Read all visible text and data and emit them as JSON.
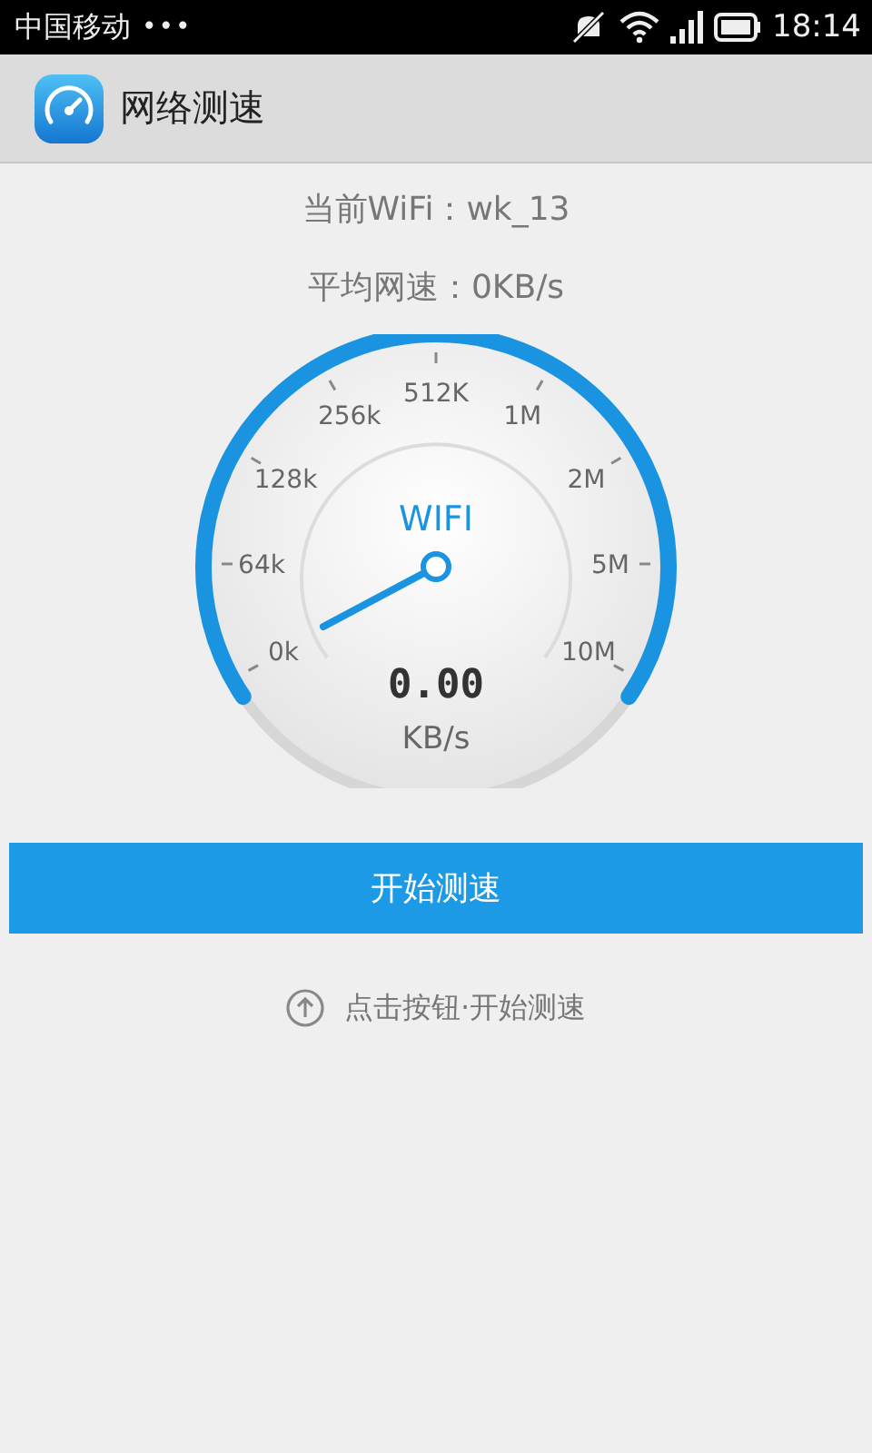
{
  "status_bar": {
    "carrier": "中国移动",
    "notifications": "•••",
    "time": "18:14"
  },
  "app_bar": {
    "title": "网络测速"
  },
  "info": [
    {
      "label": "当前WiFi：",
      "value": "wk_13"
    },
    {
      "label": "平均网速：",
      "value": "0KB/s"
    }
  ],
  "gauge": {
    "title": "WIFI",
    "scale": [
      "0k",
      "64k",
      "128k",
      "256k",
      "512K",
      "1M",
      "2M",
      "5M",
      "10M"
    ],
    "reading": "0.00",
    "unit": "KB/s"
  },
  "start_button": {
    "label": "开始测速"
  },
  "hint": {
    "text": "点击按钮·开始测速"
  }
}
